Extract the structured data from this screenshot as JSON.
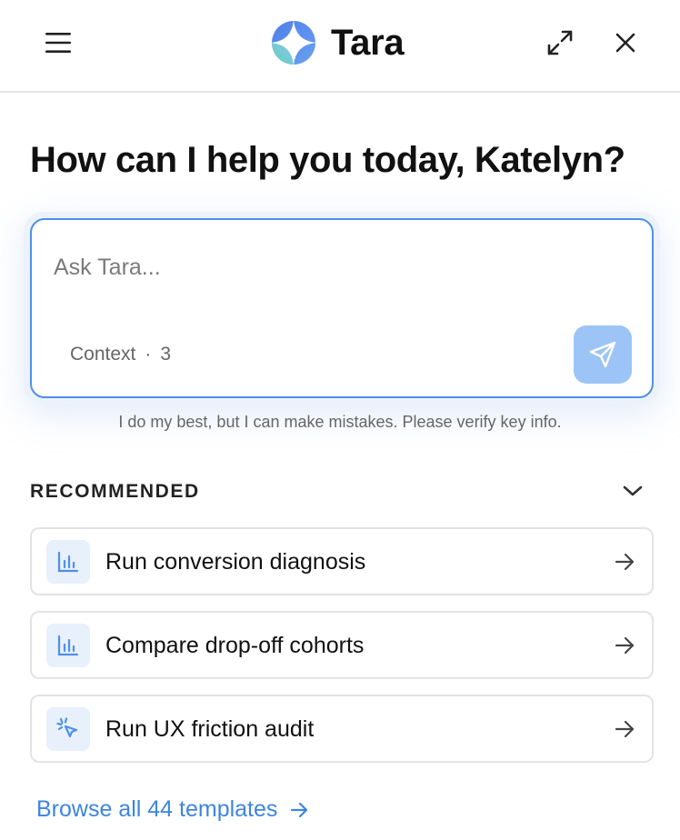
{
  "header": {
    "title": "Tara",
    "menu_icon": "hamburger-menu-icon",
    "expand_icon": "expand-icon",
    "close_icon": "close-icon"
  },
  "greeting": "How can I help you today, Katelyn?",
  "ask": {
    "placeholder": "Ask Tara...",
    "value": "",
    "context_label": "Context",
    "context_separator": "·",
    "context_count": "3",
    "send_icon": "paper-plane-icon"
  },
  "disclaimer": "I do my best, but I can make mistakes. Please verify key info.",
  "recommended": {
    "heading": "RECOMMENDED",
    "items": [
      {
        "label": "Run conversion diagnosis",
        "icon": "bar-chart-icon"
      },
      {
        "label": "Compare drop-off cohorts",
        "icon": "bar-chart-icon"
      },
      {
        "label": "Run UX friction audit",
        "icon": "cursor-click-icon"
      }
    ]
  },
  "browse_link": "Browse all 44 templates",
  "colors": {
    "accent": "#3d85e0",
    "input_border": "#4f8fe8",
    "send_button": "#9cc4f6",
    "icon_tile": "#e8f0fc"
  }
}
